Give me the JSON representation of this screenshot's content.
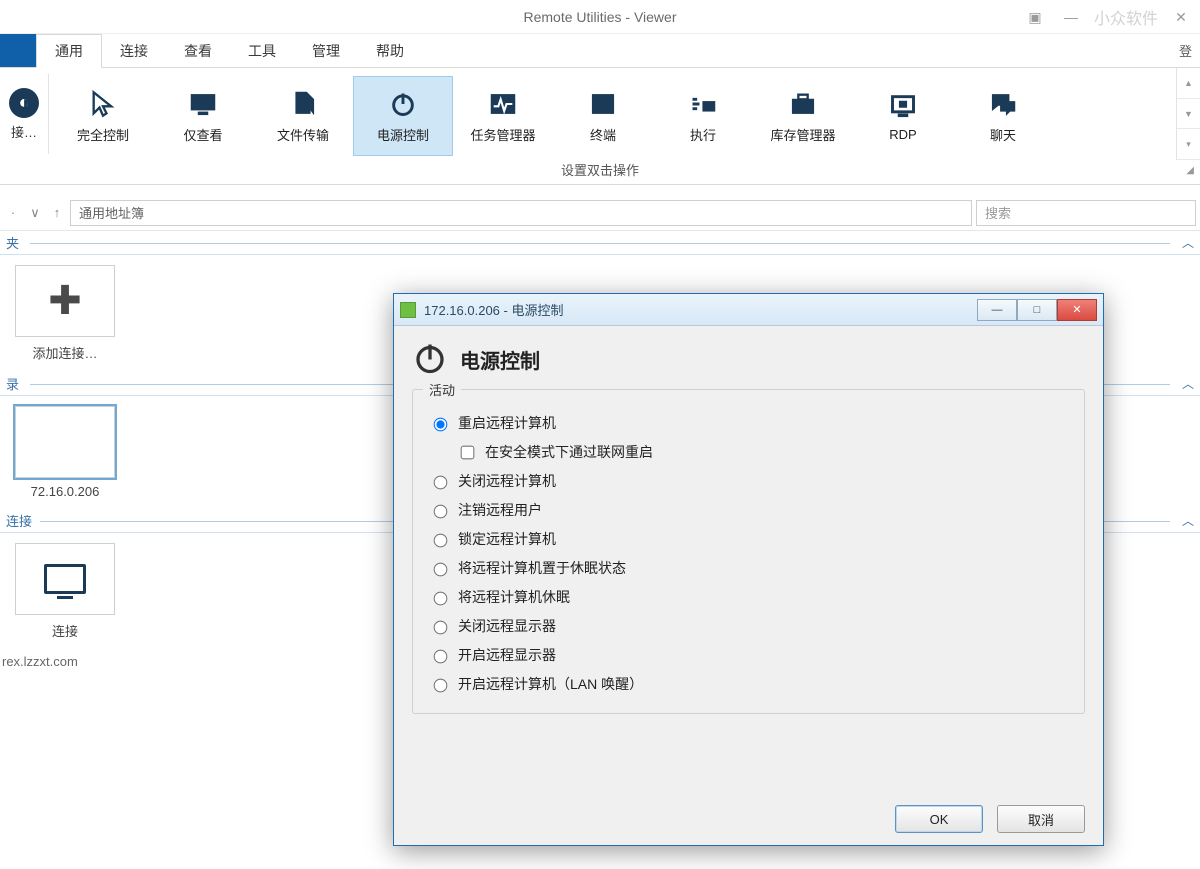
{
  "window": {
    "title": "Remote Utilities - Viewer",
    "watermark": "小众软件"
  },
  "menu": {
    "general": "通用",
    "connect": "连接",
    "view": "查看",
    "tools": "工具",
    "manage": "管理",
    "help": "帮助",
    "login": "登"
  },
  "ribbon": {
    "connect": "接…",
    "full_control": "完全控制",
    "view_only": "仅查看",
    "file_transfer": "文件传输",
    "power_control": "电源控制",
    "task_manager": "任务管理器",
    "terminal": "终端",
    "execute": "执行",
    "inventory": "库存管理器",
    "rdp": "RDP",
    "chat": "聊天",
    "group_label": "设置双击操作"
  },
  "nav": {
    "breadcrumb": "通用地址簿",
    "search_placeholder": "搜索"
  },
  "panels": {
    "folder": "夹",
    "add_connection": "添加连接…",
    "records": "录",
    "host_ip": "72.16.0.206",
    "connection": "连接",
    "local_label": "连接",
    "footer": "rex.lzzxt.com"
  },
  "dialog": {
    "title": "172.16.0.206 - 电源控制",
    "heading": "电源控制",
    "group": "活动",
    "options": {
      "restart": "重启远程计算机",
      "safe_mode": "在安全模式下通过联网重启",
      "shutdown": "关闭远程计算机",
      "logoff": "注销远程用户",
      "lock": "锁定远程计算机",
      "sleep": "将远程计算机置于休眠状态",
      "hibernate": "将远程计算机休眠",
      "monitor_off": "关闭远程显示器",
      "monitor_on": "开启远程显示器",
      "wol": "开启远程计算机（LAN 唤醒）"
    },
    "ok": "OK",
    "cancel": "取消"
  }
}
